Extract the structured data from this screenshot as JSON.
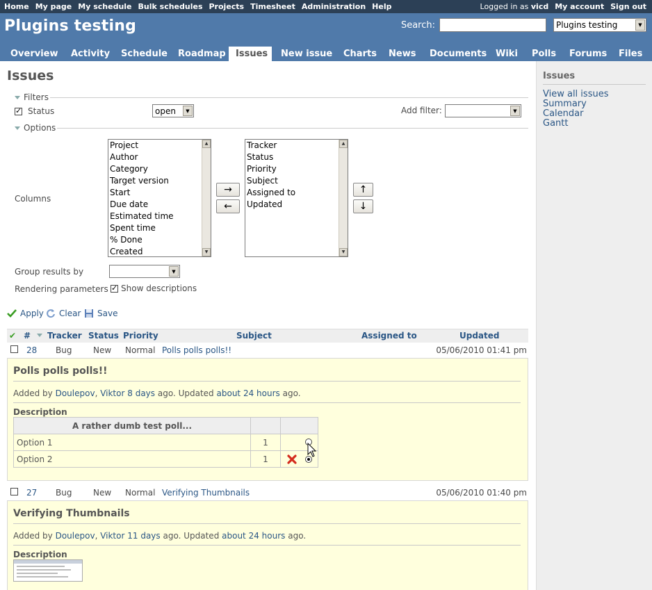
{
  "top_menu": {
    "left": [
      "Home",
      "My page",
      "My schedule",
      "Bulk schedules",
      "Projects",
      "Timesheet",
      "Administration",
      "Help"
    ],
    "logged_as_prefix": "Logged in as",
    "user": "vicd",
    "right": [
      "My account",
      "Sign out"
    ]
  },
  "header": {
    "title": "Plugins testing",
    "search_label": "Search:",
    "search_value": "",
    "project_select": "Plugins testing"
  },
  "main_menu": [
    "Overview",
    "Activity",
    "Schedule",
    "Roadmap",
    "Issues",
    "New issue",
    "Charts",
    "News",
    "Documents",
    "Wiki",
    "Polls",
    "Forums",
    "Files"
  ],
  "main_menu_selected": "Issues",
  "page_title": "Issues",
  "filters": {
    "legend": "Filters",
    "status_label": "Status",
    "status_checked": true,
    "status_value": "open",
    "add_filter_label": "Add filter:",
    "add_filter_value": ""
  },
  "options": {
    "legend": "Options",
    "columns_label": "Columns",
    "available_columns": [
      "Project",
      "Author",
      "Category",
      "Target version",
      "Start",
      "Due date",
      "Estimated time",
      "Spent time",
      "% Done",
      "Created"
    ],
    "selected_columns": [
      "Tracker",
      "Status",
      "Priority",
      "Subject",
      "Assigned to",
      "Updated"
    ],
    "btn_add": "→",
    "btn_remove": "←",
    "btn_up": "↑",
    "btn_down": "↓",
    "group_label": "Group results by",
    "group_value": "",
    "render_label": "Rendering parameters",
    "show_desc_label": "Show descriptions",
    "show_desc_checked": true
  },
  "actions": {
    "apply": "Apply",
    "clear": "Clear",
    "save": "Save"
  },
  "list_headers": {
    "num": "#",
    "tracker": "Tracker",
    "status": "Status",
    "priority": "Priority",
    "subject": "Subject",
    "assigned": "Assigned to",
    "updated": "Updated"
  },
  "issues": [
    {
      "id": "28",
      "tracker": "Bug",
      "status": "New",
      "priority": "Normal",
      "subject": "Polls polls polls!!",
      "updated": "05/06/2010 01:41 pm",
      "heading": "Polls polls polls!!",
      "added_by": "Added by",
      "author_last": "Doulepov",
      "author_first": "Viktor",
      "age": "8 days",
      "ago_updated": "ago. Updated",
      "updated_ago": "about 24 hours",
      "ago_end": "ago.",
      "description_label": "Description",
      "poll": {
        "question": "A rather dumb test poll...",
        "options": [
          {
            "label": "Option 1",
            "count": "1"
          },
          {
            "label": "Option 2",
            "count": "1"
          }
        ]
      }
    },
    {
      "id": "27",
      "tracker": "Bug",
      "status": "New",
      "priority": "Normal",
      "subject": "Verifying Thumbnails",
      "updated": "05/06/2010 01:40 pm",
      "heading": "Verifying Thumbnails",
      "added_by": "Added by",
      "author_last": "Doulepov",
      "author_first": "Viktor",
      "age": "11 days",
      "ago_updated": "ago. Updated",
      "updated_ago": "about 24 hours",
      "ago_end": "ago.",
      "description_label": "Description"
    }
  ],
  "sidebar": {
    "heading": "Issues",
    "links": [
      "View all issues",
      "Summary",
      "Calendar",
      "Gantt"
    ]
  },
  "colors": {
    "top_menu": "#2c4056",
    "header": "#507aaa",
    "link": "#2a5685",
    "description_bg": "#ffffdd",
    "sidebar_bg": "#eeeeee"
  }
}
